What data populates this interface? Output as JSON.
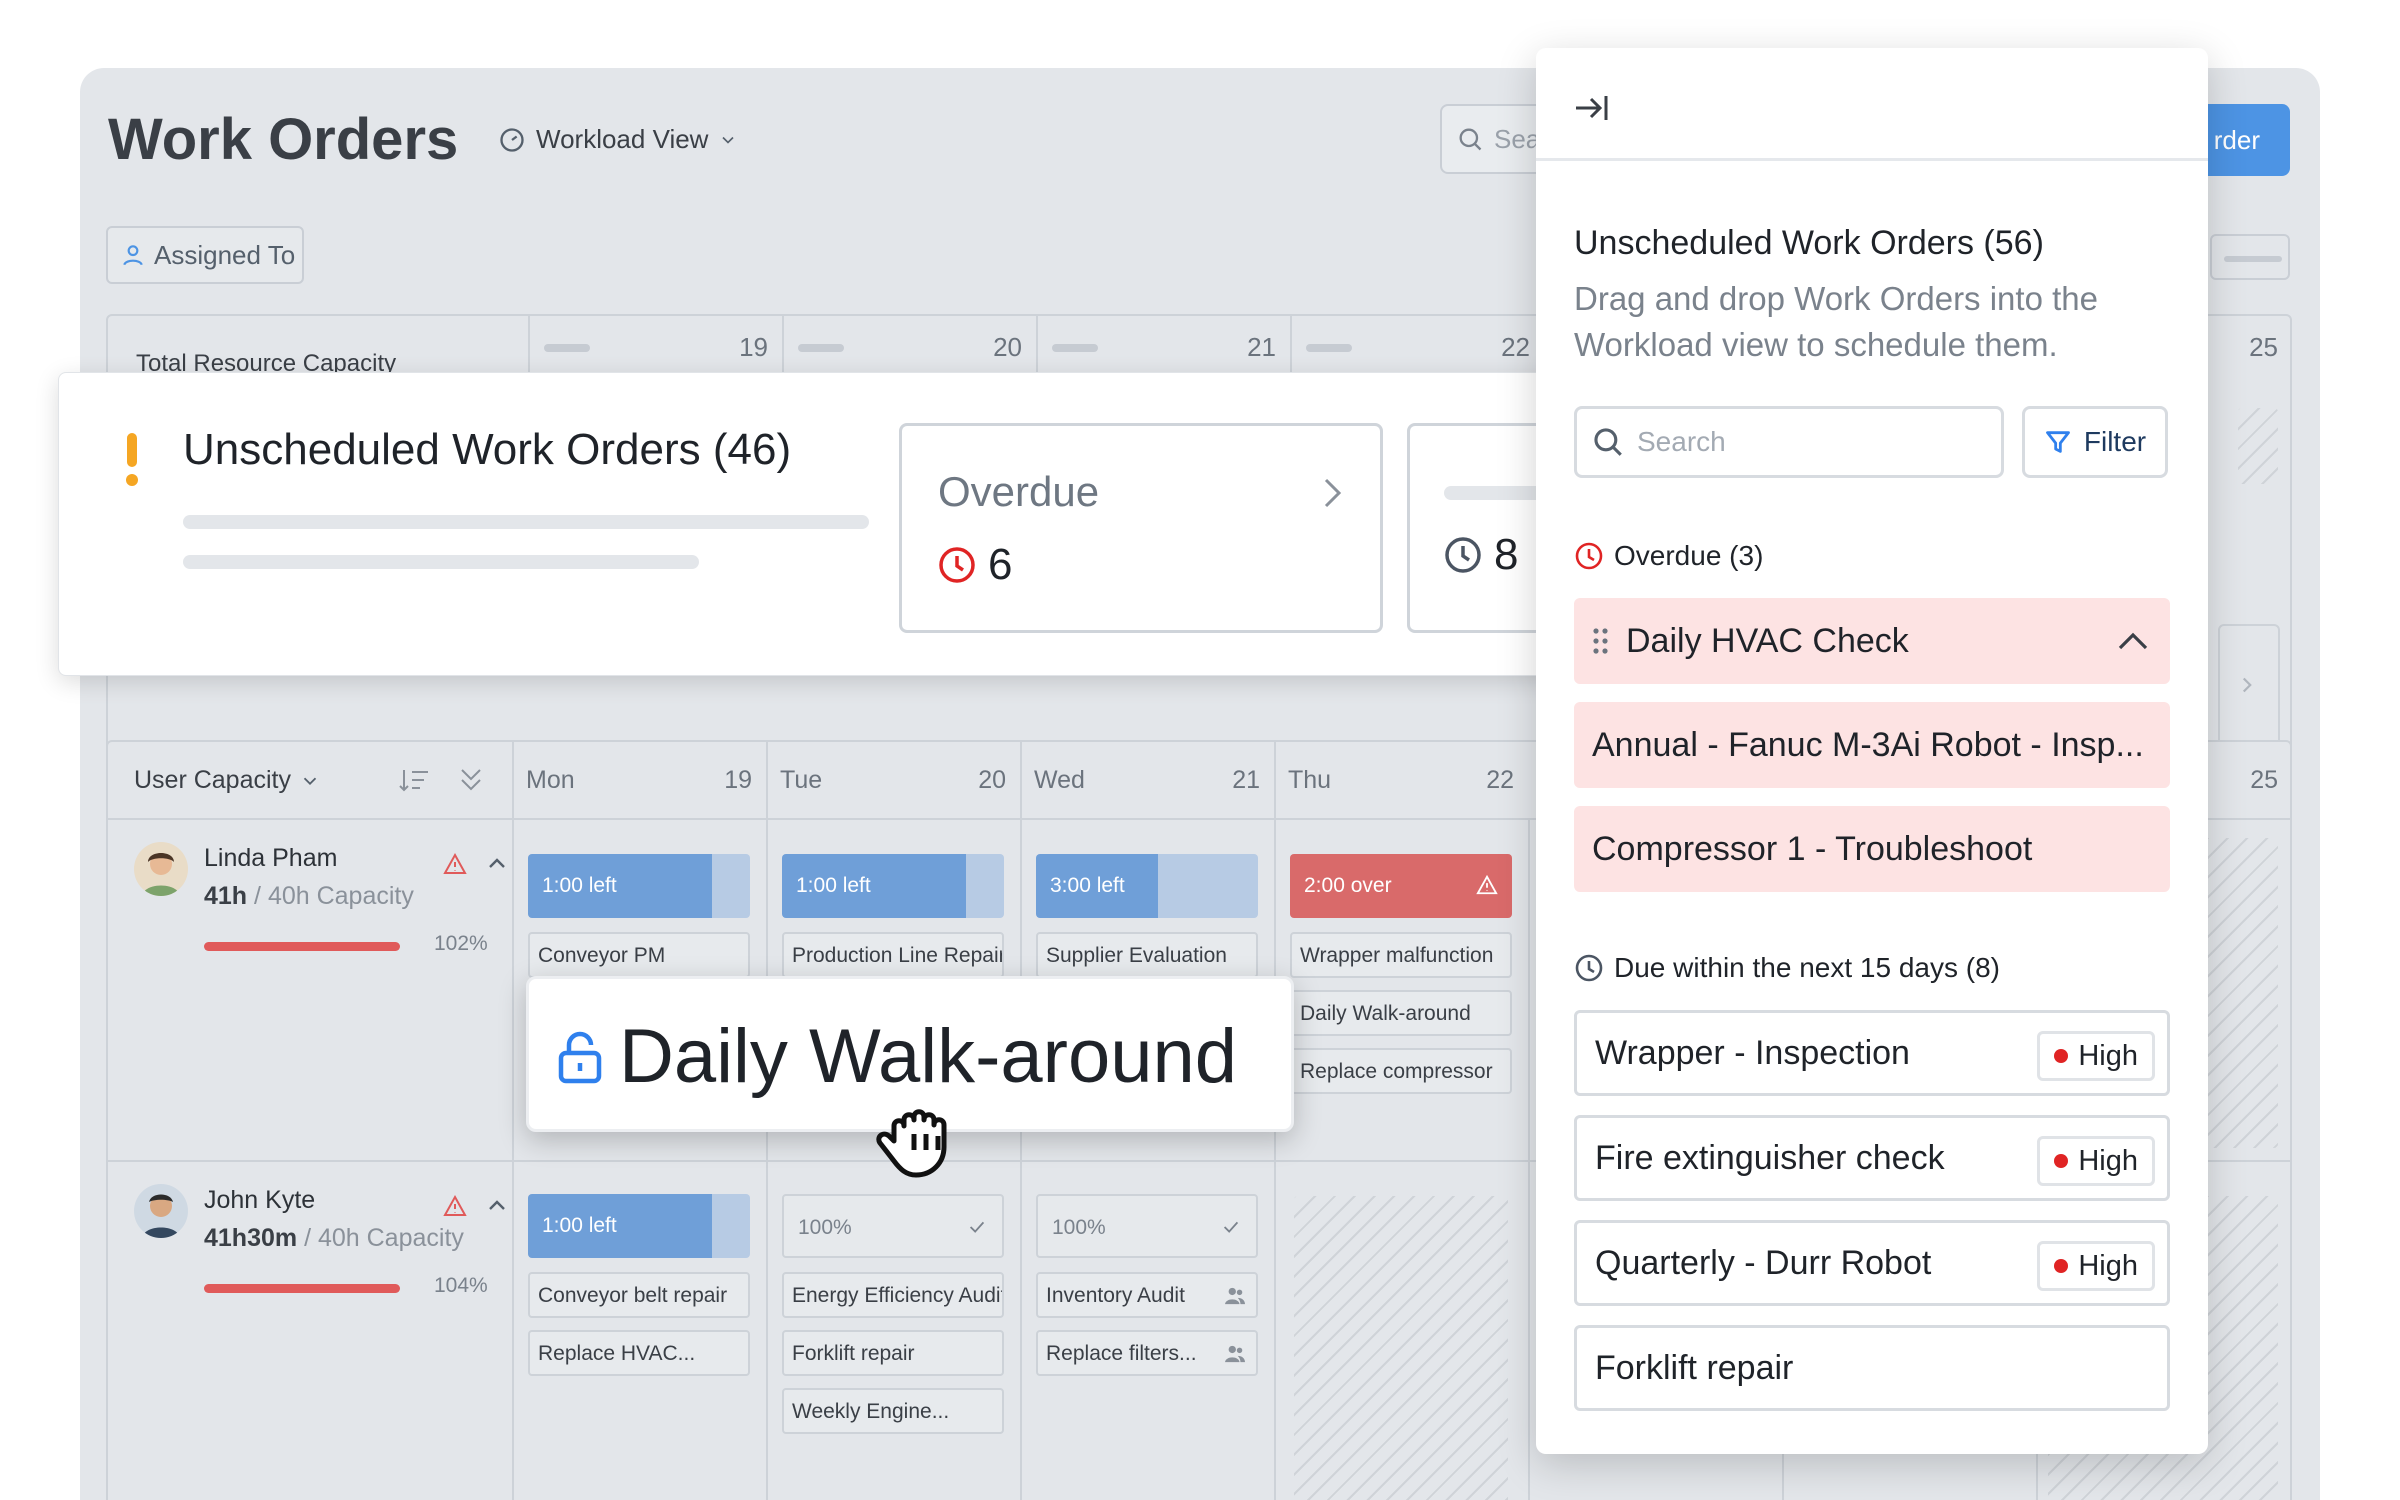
{
  "app": {
    "title": "Work Orders",
    "view_label": "Workload View",
    "search_placeholder": "Sea",
    "create_label": "rder",
    "assigned_filter": "Assigned To",
    "total_capacity_label": "Total Resource Capacity"
  },
  "grid_dates": [
    "19",
    "20",
    "21",
    "22",
    "25"
  ],
  "user_capacity": {
    "title": "User Capacity",
    "days": [
      {
        "name": "Mon",
        "date": "19"
      },
      {
        "name": "Tue",
        "date": "20"
      },
      {
        "name": "Wed",
        "date": "21"
      },
      {
        "name": "Thu",
        "date": "22"
      },
      {
        "name": "",
        "date": "25"
      }
    ]
  },
  "users": [
    {
      "name": "Linda Pham",
      "hours": "41h",
      "capacity": "/ 40h Capacity",
      "percent": "102%",
      "cells": [
        {
          "label": "1:00 left",
          "fill": 0.83
        },
        {
          "label": "1:00 left",
          "fill": 0.83
        },
        {
          "label": "3:00 left",
          "fill": 0.55
        },
        {
          "label": "2:00 over",
          "fill": 1.0
        }
      ],
      "orders": {
        "mon": [
          "Conveyor PM"
        ],
        "tue": [
          "Production Line Repair"
        ],
        "wed": [
          "Supplier Evaluation"
        ],
        "thu": [
          "Wrapper malfunction",
          "Daily Walk-around",
          "Replace compressor"
        ]
      }
    },
    {
      "name": "John Kyte",
      "hours": "41h30m",
      "capacity": "/ 40h Capacity",
      "percent": "104%",
      "cells": [
        {
          "label": "1:00 left",
          "fill": 0.83
        },
        {
          "label": "100%",
          "fill": 1.0
        },
        {
          "label": "100%",
          "fill": 1.0
        }
      ],
      "orders": {
        "mon": [
          "Conveyor belt repair",
          "Replace HVAC..."
        ],
        "tue": [
          "Energy Efficiency Audit",
          "Forklift repair",
          "Weekly Engine..."
        ],
        "wed": [
          "Inventory Audit",
          "Replace filters..."
        ]
      }
    }
  ],
  "summary": {
    "title": "Unscheduled Work Orders (46)",
    "overdue_label": "Overdue",
    "overdue_count": "6",
    "due_count": "8"
  },
  "dragged": {
    "title": "Daily Walk-around"
  },
  "panel": {
    "title": "Unscheduled Work Orders (56)",
    "description": "Drag and drop Work Orders into the Workload view to schedule them.",
    "search_placeholder": "Search",
    "filter_label": "Filter",
    "overdue_section": "Overdue (3)",
    "overdue_items": [
      "Daily HVAC Check",
      "Annual - Fanuc M-3Ai Robot - Insp...",
      "Compressor 1 - Troubleshoot"
    ],
    "due_section": "Due within the next 15 days (8)",
    "due_items": [
      {
        "name": "Wrapper - Inspection",
        "priority": "High"
      },
      {
        "name": "Fire extinguisher check",
        "priority": "High"
      },
      {
        "name": "Quarterly - Durr Robot",
        "priority": "High"
      },
      {
        "name": "Forklift repair",
        "priority": ""
      }
    ]
  },
  "colors": {
    "accent": "#4d94e4",
    "overdue_red": "#e02424",
    "overdue_bg": "#fde3e3",
    "capacity_blue": "#6f9fd8",
    "over_red": "#d96a6a"
  },
  "icons": [
    "gauge-icon",
    "search-icon",
    "user-icon",
    "sort-icon",
    "collapse-all-icon",
    "warning-icon",
    "chevron-up-icon",
    "exclamation-icon",
    "clock-icon",
    "chevron-right-icon",
    "unlock-icon",
    "grab-hand-icon",
    "collapse-panel-icon",
    "filter-icon",
    "drag-handle-icon",
    "check-icon",
    "team-icon"
  ]
}
